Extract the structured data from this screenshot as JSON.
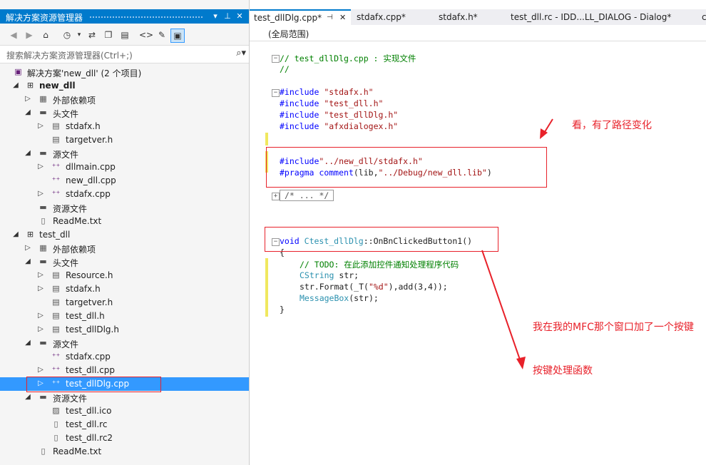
{
  "solution_explorer": {
    "title": "解决方案资源管理器",
    "search_placeholder": "搜索解决方案资源管理器(Ctrl+;)",
    "tree": [
      {
        "label": "解决方案'new_dll' (2 个项目)",
        "icon": "solution-icon"
      },
      {
        "label": "new_dll",
        "icon": "project-icon"
      },
      {
        "label": "外部依赖项",
        "icon": "dependencies-icon"
      },
      {
        "label": "头文件",
        "icon": "folder-icon"
      },
      {
        "label": "stdafx.h",
        "icon": "header-file-icon"
      },
      {
        "label": "targetver.h",
        "icon": "header-file-icon"
      },
      {
        "label": "源文件",
        "icon": "folder-icon"
      },
      {
        "label": "dllmain.cpp",
        "icon": "cpp-file-icon"
      },
      {
        "label": "new_dll.cpp",
        "icon": "cpp-file-icon"
      },
      {
        "label": "stdafx.cpp",
        "icon": "cpp-file-icon"
      },
      {
        "label": "资源文件",
        "icon": "folder-icon"
      },
      {
        "label": "ReadMe.txt",
        "icon": "text-file-icon"
      },
      {
        "label": "test_dll",
        "icon": "project-icon"
      },
      {
        "label": "外部依赖项",
        "icon": "dependencies-icon"
      },
      {
        "label": "头文件",
        "icon": "folder-icon"
      },
      {
        "label": "Resource.h",
        "icon": "header-file-icon"
      },
      {
        "label": "stdafx.h",
        "icon": "header-file-icon"
      },
      {
        "label": "targetver.h",
        "icon": "header-file-icon"
      },
      {
        "label": "test_dll.h",
        "icon": "header-file-icon"
      },
      {
        "label": "test_dllDlg.h",
        "icon": "header-file-icon"
      },
      {
        "label": "源文件",
        "icon": "folder-icon"
      },
      {
        "label": "stdafx.cpp",
        "icon": "cpp-file-icon"
      },
      {
        "label": "test_dll.cpp",
        "icon": "cpp-file-icon"
      },
      {
        "label": "test_dllDlg.cpp",
        "icon": "cpp-file-icon"
      },
      {
        "label": "资源文件",
        "icon": "folder-icon"
      },
      {
        "label": "test_dll.ico",
        "icon": "image-file-icon"
      },
      {
        "label": "test_dll.rc",
        "icon": "resource-file-icon"
      },
      {
        "label": "test_dll.rc2",
        "icon": "resource-file-icon"
      },
      {
        "label": "ReadMe.txt",
        "icon": "text-file-icon"
      }
    ]
  },
  "editor": {
    "tabs": [
      "test_dllDlg.cpp*",
      "stdafx.cpp*",
      "stdafx.h*",
      "test_dll.rc - IDD...LL_DIALOG - Dialog*",
      "c"
    ],
    "scope": "(全局范围)",
    "code": {
      "c1": "// test_dllDlg.cpp : 实现文件",
      "c2": "//",
      "inc1": "#include \"stdafx.h\"",
      "inc2": "#include \"test_dll.h\"",
      "inc3": "#include \"test_dllDlg.h\"",
      "inc4": "#include \"afxdialogex.h\"",
      "inc5": "#include\"../new_dll/stdafx.h\"",
      "pragma": "#pragma comment(lib,\"../Debug/new_dll.lib\")",
      "collapsed": "/* ... */",
      "fn_void": "void",
      "fn_class": "Ctest_dllDlg",
      "fn_rest": "::OnBnClickedButton1()",
      "brace_open": "{",
      "todo": "// TODO: 在此添加控件通知处理程序代码",
      "cstring_type": "CString",
      "cstring_rest": " str;",
      "format": "str.Format(_T(\"%d\"),add(3,4));",
      "msgbox_fn": "MessageBox",
      "msgbox_rest": "(str);",
      "brace_close": "}"
    }
  },
  "annotations": {
    "path_changed": "看，有了路径变化",
    "added_button": "我在我的MFC那个窗口加了一个按键",
    "handler": "按键处理函数"
  },
  "colors": {
    "accent": "#007acc",
    "selection": "#3399ff",
    "annotation": "#e8212a"
  }
}
